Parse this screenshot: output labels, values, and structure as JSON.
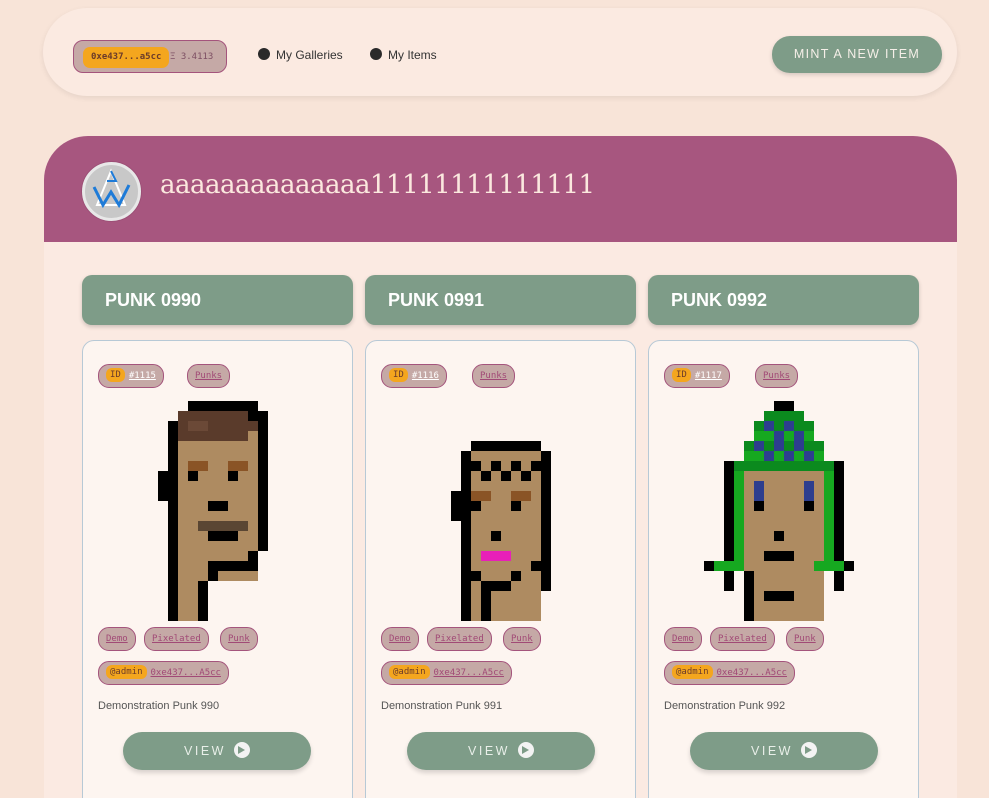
{
  "header": {
    "wallet_address": "0xe437...a5cc",
    "wallet_balance": "Ξ 3.4113",
    "nav": [
      {
        "label": "My Galleries"
      },
      {
        "label": "My Items"
      }
    ],
    "mint_button": "MINT A NEW ITEM"
  },
  "gallery": {
    "title": "aaaaaaaaaaaaaa11111111111111",
    "cards": [
      {
        "title": "PUNK 0990",
        "id_label": "ID",
        "id_value": "#1115",
        "collection": "Punks",
        "tags": [
          "Demo",
          "Pixelated",
          "Punk"
        ],
        "owner_handle": "@admin",
        "owner_address": "0xe437...A5cc",
        "description": "Demonstration Punk 990",
        "view_label": "VIEW"
      },
      {
        "title": "PUNK 0991",
        "id_label": "ID",
        "id_value": "#1116",
        "collection": "Punks",
        "tags": [
          "Demo",
          "Pixelated",
          "Punk"
        ],
        "owner_handle": "@admin",
        "owner_address": "0xe437...A5cc",
        "description": "Demonstration Punk 991",
        "view_label": "VIEW"
      },
      {
        "title": "PUNK 0992",
        "id_label": "ID",
        "id_value": "#1117",
        "collection": "Punks",
        "tags": [
          "Demo",
          "Pixelated",
          "Punk"
        ],
        "owner_handle": "@admin",
        "owner_address": "0xe437...A5cc",
        "description": "Demonstration Punk 992",
        "view_label": "VIEW"
      }
    ]
  },
  "colors": {
    "background": "#f8e4d8",
    "accent_sage": "#7e9c88",
    "accent_plum": "#a7567f",
    "highlight_orange": "#f4a61e"
  }
}
